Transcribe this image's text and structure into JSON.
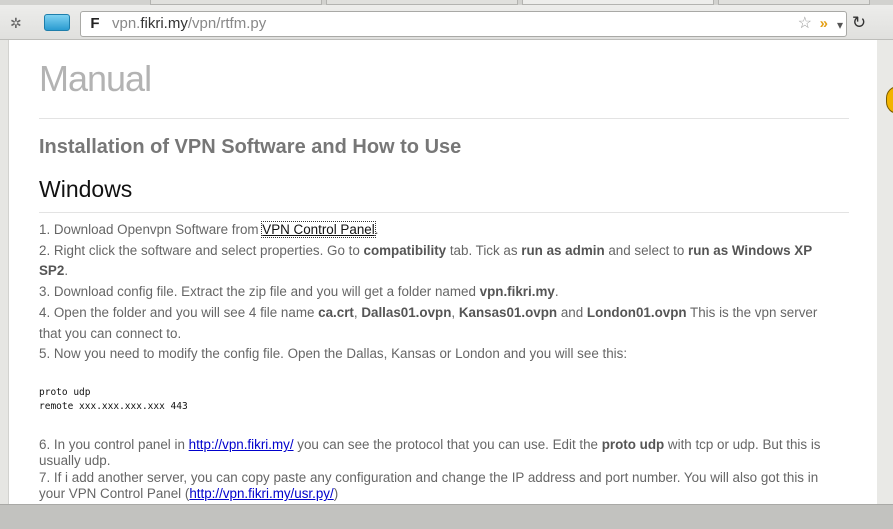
{
  "toolbar": {
    "favicon_letter": "F",
    "url_prefix": "vpn.",
    "url_domain": "fikri.my",
    "url_path": "/vpn/rtfm.py",
    "star_glyph": "☆",
    "rss_glyph": "»",
    "dropdown_glyph": "▾",
    "reload_glyph": "↻"
  },
  "page": {
    "title": "Manual",
    "subtitle": "Installation of VPN Software and How to Use",
    "section": "Windows",
    "steps": {
      "s1_pre": "1. Download Openvpn Software from ",
      "s1_link": "VPN Control Panel",
      "s1_post": ".",
      "s2_a": "2. Right click the software and select properties. Go to ",
      "s2_b": "compatibility",
      "s2_c": " tab. Tick as ",
      "s2_d": "run as admin",
      "s2_e": " and select to ",
      "s2_f": "run as Windows XP SP2",
      "s2_g": ".",
      "s3_a": "3. Download config file. Extract the zip file and you will get a folder named ",
      "s3_b": "vpn.fikri.my",
      "s3_c": ".",
      "s4_a": "4. Open the folder and you will see 4 file name ",
      "s4_b": "ca.crt",
      "s4_c": ", ",
      "s4_d": "Dallas01.ovpn",
      "s4_e": ", ",
      "s4_f": "Kansas01.ovpn",
      "s4_g": " and ",
      "s4_h": "London01.ovpn",
      "s4_i": " This is the vpn server that you can connect to.",
      "s5": "5. Now you need to modify the config file. Open the Dallas, Kansas or London and you will see this:",
      "s6_a": "6. In you control panel in ",
      "s6_link": "http://vpn.fikri.my/",
      "s6_b": " you can see the protocol that you can use. Edit the ",
      "s6_c": "proto udp",
      "s6_d": " with tcp or udp. But this is usually udp.",
      "s7_a": "7. If i add another server, you can copy paste any configuration and change the IP address and port number. You will also got this in your VPN Control Panel (",
      "s7_link": "http://vpn.fikri.my/usr.py/",
      "s7_b": ")"
    },
    "code_line1": "proto udp",
    "code_line2": "remote xxx.xxx.xxx.xxx 443"
  }
}
